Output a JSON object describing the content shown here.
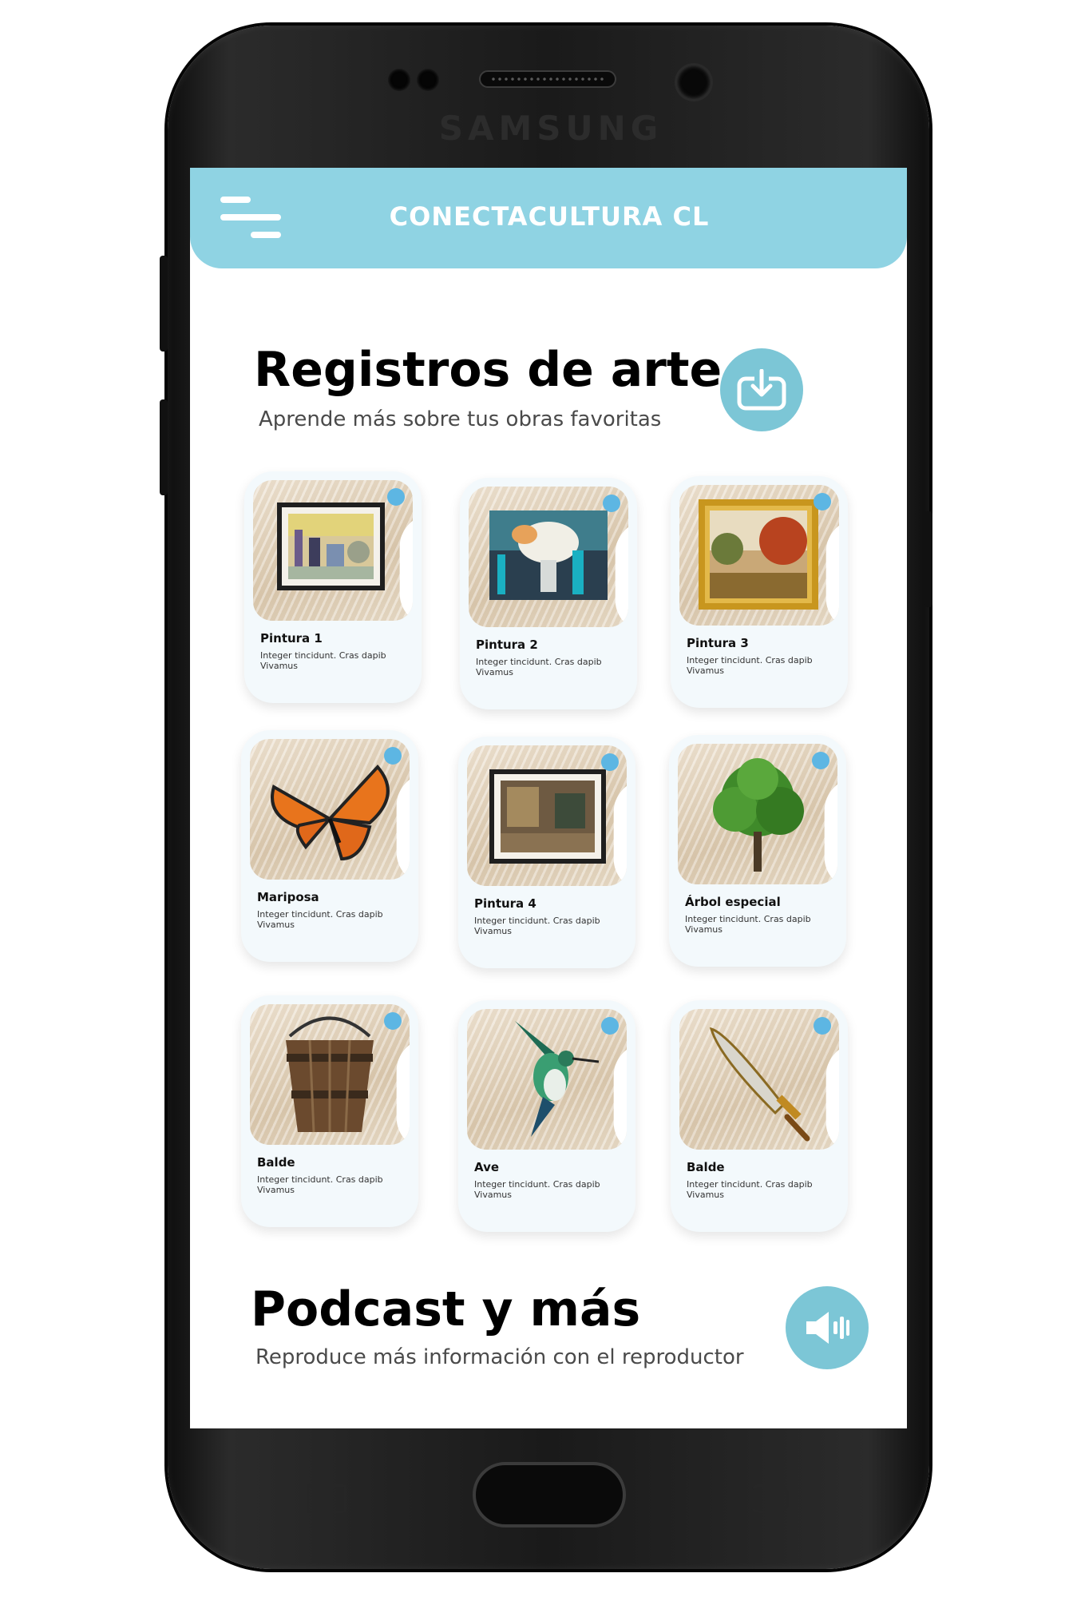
{
  "device": {
    "brand": "SAMSUNG"
  },
  "header": {
    "title": "CONECTACULTURA CL",
    "menu_icon": "hamburger-icon"
  },
  "registros": {
    "title": "Registros de arte",
    "subtitle": "Aprende más sobre tus obras favoritas",
    "action_icon": "download-icon"
  },
  "items": [
    {
      "title": "Pintura 1",
      "desc": "Integer tincidunt. Cras dapib Vivamus",
      "image": "framed-painting-city"
    },
    {
      "title": "Pintura 2",
      "desc": "Integer tincidunt. Cras dapib Vivamus",
      "image": "abstract-canvas-teal"
    },
    {
      "title": "Pintura 3",
      "desc": "Integer tincidunt. Cras dapib Vivamus",
      "image": "gold-frame-landscape"
    },
    {
      "title": "Mariposa",
      "desc": "Integer tincidunt. Cras dapib Vivamus",
      "image": "monarch-butterfly"
    },
    {
      "title": "Pintura 4",
      "desc": "Integer tincidunt. Cras dapib Vivamus",
      "image": "framed-painting-interior"
    },
    {
      "title": "Árbol especial",
      "desc": "Integer tincidunt. Cras dapib Vivamus",
      "image": "green-tree"
    },
    {
      "title": "Balde",
      "desc": "Integer tincidunt. Cras dapib Vivamus",
      "image": "wooden-bucket"
    },
    {
      "title": "Ave",
      "desc": "Integer tincidunt. Cras dapib Vivamus",
      "image": "hummingbird"
    },
    {
      "title": "Balde",
      "desc": "Integer tincidunt. Cras dapib Vivamus",
      "image": "golden-sword"
    }
  ],
  "podcast": {
    "title": "Podcast y más",
    "subtitle": "Reproduce más información con el reproductor",
    "action_icon": "speaker-icon"
  },
  "colors": {
    "header": "#8fd3e3",
    "accent": "#7cc6d6",
    "badge": "#5db6e3",
    "card_bg": "#f3f9fc"
  }
}
